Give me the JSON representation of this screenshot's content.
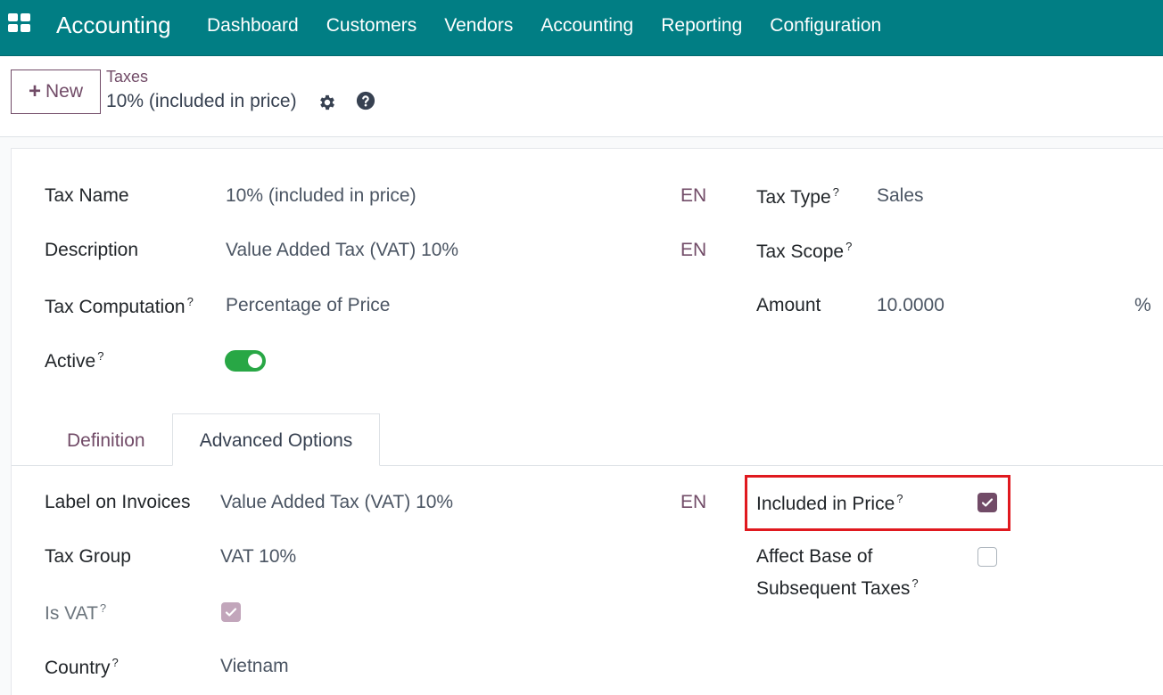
{
  "navbar": {
    "brand": "Accounting",
    "menu": [
      "Dashboard",
      "Customers",
      "Vendors",
      "Accounting",
      "Reporting",
      "Configuration"
    ]
  },
  "control_panel": {
    "new_label": "New",
    "breadcrumb": "Taxes",
    "record_title": "10% (included in price)"
  },
  "form": {
    "tax_name": {
      "label": "Tax Name",
      "value": "10% (included in price)",
      "lang": "EN"
    },
    "description": {
      "label": "Description",
      "value": "Value Added Tax (VAT) 10%",
      "lang": "EN"
    },
    "tax_computation": {
      "label": "Tax Computation",
      "value": "Percentage of Price"
    },
    "active": {
      "label": "Active",
      "value": true
    },
    "tax_type": {
      "label": "Tax Type",
      "value": "Sales"
    },
    "tax_scope": {
      "label": "Tax Scope",
      "value": ""
    },
    "amount": {
      "label": "Amount",
      "value": "10.0000",
      "unit": "%"
    },
    "tooltip_mark": "?"
  },
  "tabs": {
    "definition": "Definition",
    "advanced": "Advanced Options",
    "active_tab": "Advanced Options"
  },
  "advanced": {
    "label_on_invoices": {
      "label": "Label on Invoices",
      "value": "Value Added Tax (VAT) 10%",
      "lang": "EN"
    },
    "tax_group": {
      "label": "Tax Group",
      "value": "VAT 10%"
    },
    "is_vat": {
      "label": "Is VAT",
      "checked": true
    },
    "country": {
      "label": "Country",
      "value": "Vietnam"
    },
    "included_in_price": {
      "label": "Included in Price",
      "checked": true
    },
    "affect_base": {
      "label_line1": "Affect Base of",
      "label_line2": "Subsequent Taxes",
      "checked": false
    }
  },
  "colors": {
    "navbar": "#017e84",
    "accent": "#714b67",
    "toggle_on": "#28a745",
    "highlight": "#e0191f"
  }
}
